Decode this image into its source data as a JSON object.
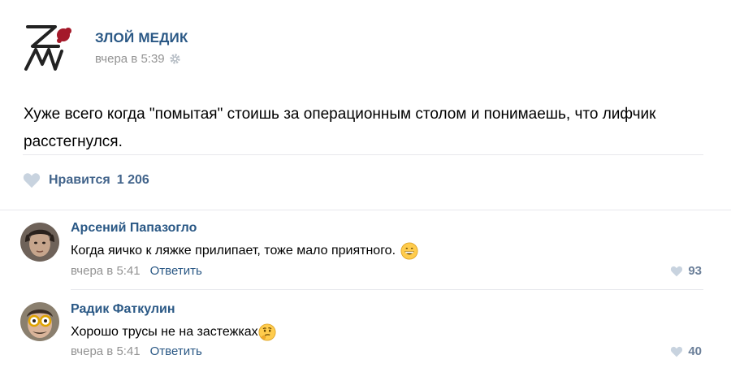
{
  "post": {
    "group_name": "ЗЛОЙ МЕДИК",
    "timestamp": "вчера в 5:39",
    "text": "Хуже всего когда \"помытая\" стоишь за операционным столом и понимаешь, что лифчик расстегнулся.",
    "like_label": "Нравится",
    "like_count": "1 206"
  },
  "comments": [
    {
      "author": "Арсений Папазогло",
      "text": "Когда яичко к ляжке прилипает, тоже мало приятного.",
      "emoji": "grinning-face-icon",
      "timestamp": "вчера в 5:41",
      "reply_label": "Ответить",
      "likes": "93"
    },
    {
      "author": "Радик Фаткулин",
      "text": "Хорошо трусы не на застежках",
      "emoji": "thinking-face-icon",
      "timestamp": "вчера в 5:41",
      "reply_label": "Ответить",
      "likes": "40"
    }
  ],
  "colors": {
    "link": "#2a5885",
    "meta": "#939393",
    "heart": "#c8d3df",
    "divider": "#e7e8ec"
  }
}
